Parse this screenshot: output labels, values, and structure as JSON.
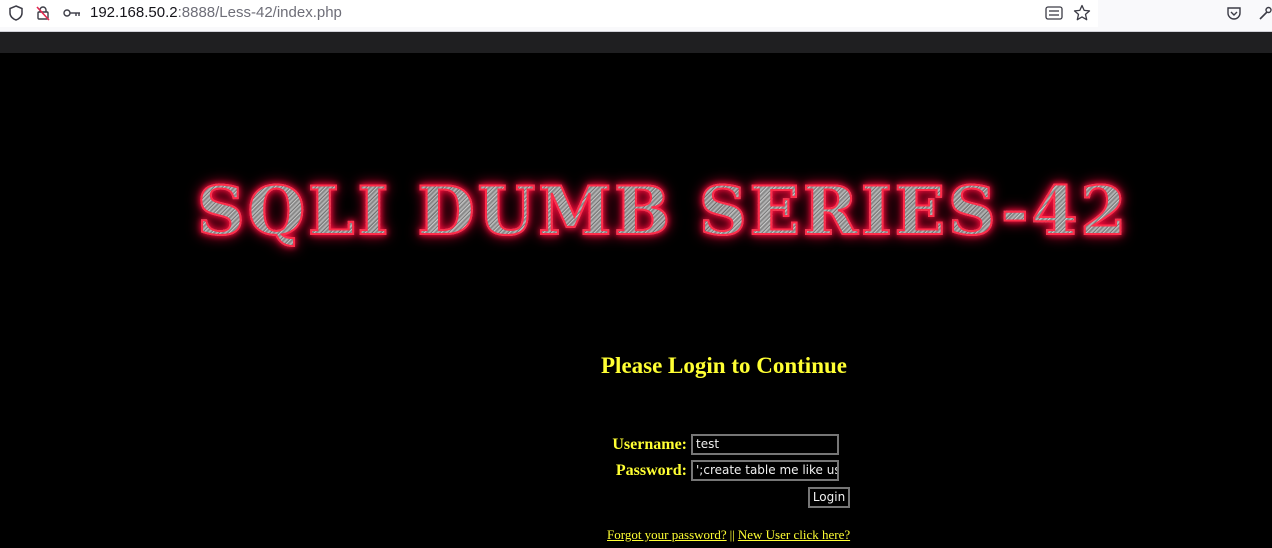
{
  "browser": {
    "url_host": "192.168.50.2",
    "url_rest": ":8888/Less-42/index.php",
    "icons": {
      "shield": "shield-icon",
      "blocked": "tracking-blocked-icon",
      "key": "key-icon",
      "reader": "reader-view-icon",
      "star": "bookmark-star-icon",
      "pocket": "pocket-icon",
      "tools": "tools-icon"
    }
  },
  "page": {
    "banner": "SQLI DUMB SERIES-42",
    "heading": "Please Login to Continue",
    "username_label": "Username:",
    "username_value": "test",
    "password_label": "Password:",
    "password_value": "';create table me like use",
    "login_button": "Login",
    "forgot_link": "Forgot your password?",
    "separator": "||",
    "new_user_link": "New User click here?"
  },
  "colors": {
    "background": "#000000",
    "text_yellow": "#ffff33",
    "banner_glow": "#ff1040"
  }
}
